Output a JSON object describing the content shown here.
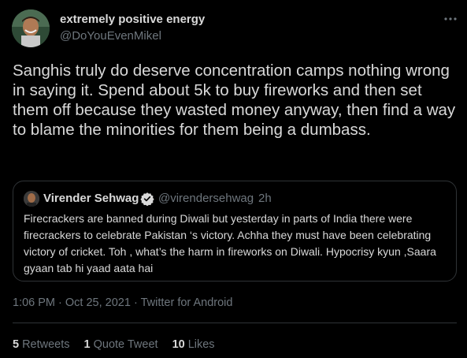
{
  "author": {
    "name": "extremely positive energy",
    "handle": "@DoYouEvenMikel"
  },
  "tweet": {
    "text": "Sanghis truly do deserve concentration camps nothing wrong in saying it. Spend about 5k to buy fireworks and then set them off because they wasted money anyway, then find a way to blame the minorities for them being a dumbass."
  },
  "quoted": {
    "name": "Virender Sehwag",
    "handle": "@virendersehwag",
    "separator": "·",
    "time": "2h",
    "text": "Firecrackers are banned during Diwali but yesterday in parts of India there were firecrackers to celebrate Pakistan ‘s victory. Achha they must have been celebrating victory of cricket. Toh , what’s the harm in fireworks on Diwali. Hypocrisy kyun ,Saara gyaan tab hi yaad aata hai",
    "verified_color": "#1d9bf0"
  },
  "meta": {
    "time": "1:06 PM",
    "date": "Oct 25, 2021",
    "source": "Twitter for Android",
    "sep": "·"
  },
  "stats": {
    "retweets_count": "5",
    "retweets_label": "Retweets",
    "quotes_count": "1",
    "quotes_label": "Quote Tweet",
    "likes_count": "10",
    "likes_label": "Likes"
  }
}
